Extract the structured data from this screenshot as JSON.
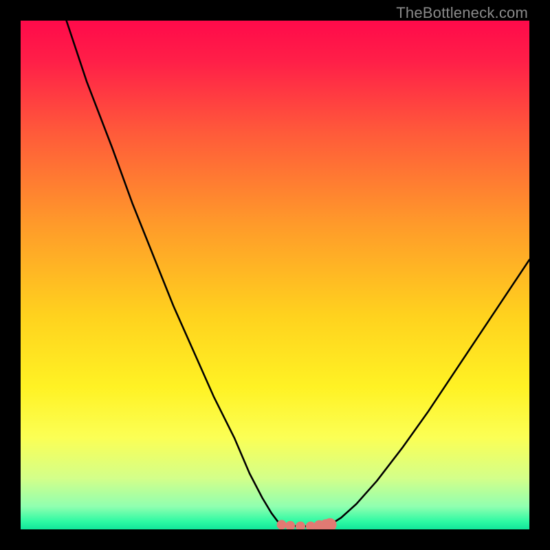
{
  "watermark": "TheBottleneck.com",
  "colors": {
    "frame": "#000000",
    "curve": "#000000",
    "marker_fill": "#e17a73",
    "marker_stroke": "#e17a73",
    "gradient_stops": [
      {
        "offset": 0.0,
        "color": "#ff0a4a"
      },
      {
        "offset": 0.08,
        "color": "#ff1f48"
      },
      {
        "offset": 0.22,
        "color": "#ff5a3a"
      },
      {
        "offset": 0.4,
        "color": "#ff9a2a"
      },
      {
        "offset": 0.58,
        "color": "#ffd21e"
      },
      {
        "offset": 0.72,
        "color": "#fff224"
      },
      {
        "offset": 0.82,
        "color": "#fbff55"
      },
      {
        "offset": 0.9,
        "color": "#d3ff8a"
      },
      {
        "offset": 0.955,
        "color": "#90ffb0"
      },
      {
        "offset": 0.985,
        "color": "#2cf9a3"
      },
      {
        "offset": 1.0,
        "color": "#12e59a"
      }
    ]
  },
  "chart_data": {
    "type": "line",
    "title": "",
    "xlabel": "",
    "ylabel": "",
    "xlim": [
      0,
      100
    ],
    "ylim": [
      0,
      100
    ],
    "series": [
      {
        "name": "left-branch",
        "x": [
          9,
          13,
          18,
          22,
          26,
          30,
          34,
          38,
          42,
          45,
          47.5,
          49.3,
          50.5,
          51.3
        ],
        "y": [
          100,
          88,
          75,
          64,
          54,
          44,
          35,
          26,
          18,
          11,
          6.2,
          3.2,
          1.6,
          0.9
        ]
      },
      {
        "name": "flat-bottom",
        "x": [
          51.3,
          53,
          55,
          57,
          59,
          60.8
        ],
        "y": [
          0.9,
          0.7,
          0.6,
          0.6,
          0.7,
          0.9
        ]
      },
      {
        "name": "right-branch",
        "x": [
          60.8,
          63,
          66,
          70,
          75,
          80,
          85,
          90,
          95,
          100
        ],
        "y": [
          0.9,
          2.3,
          5,
          9.5,
          16,
          23,
          30.5,
          38,
          45.5,
          53
        ]
      }
    ],
    "markers": {
      "name": "flat-bottom-markers",
      "points": [
        {
          "x": 51.3,
          "y": 0.9,
          "r": 0.9
        },
        {
          "x": 53.0,
          "y": 0.7,
          "r": 0.9
        },
        {
          "x": 55.0,
          "y": 0.6,
          "r": 0.9
        },
        {
          "x": 57.0,
          "y": 0.6,
          "r": 0.9
        },
        {
          "x": 58.7,
          "y": 0.7,
          "r": 1.05
        },
        {
          "x": 60.0,
          "y": 0.8,
          "r": 1.15
        },
        {
          "x": 60.8,
          "y": 0.9,
          "r": 1.25
        }
      ]
    }
  }
}
